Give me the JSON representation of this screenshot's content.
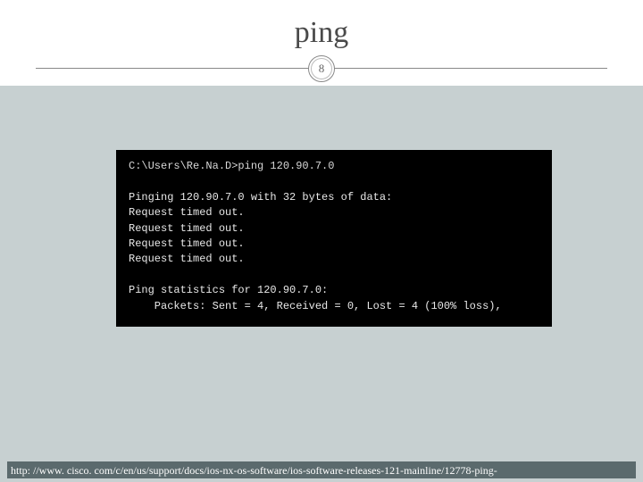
{
  "title": "ping",
  "pageNumber": "8",
  "terminal": {
    "prompt": "C:\\Users\\Re.Na.D>ping 120.90.7.0",
    "blank1": "",
    "line1": "Pinging 120.90.7.0 with 32 bytes of data:",
    "line2": "Request timed out.",
    "line3": "Request timed out.",
    "line4": "Request timed out.",
    "line5": "Request timed out.",
    "blank2": "",
    "stats1": "Ping statistics for 120.90.7.0:",
    "stats2": "    Packets: Sent = 4, Received = 0, Lost = 4 (100% loss),"
  },
  "footerUrl": "http: //www. cisco. com/c/en/us/support/docs/ios-nx-os-software/ios-software-releases-121-mainline/12778-ping-"
}
